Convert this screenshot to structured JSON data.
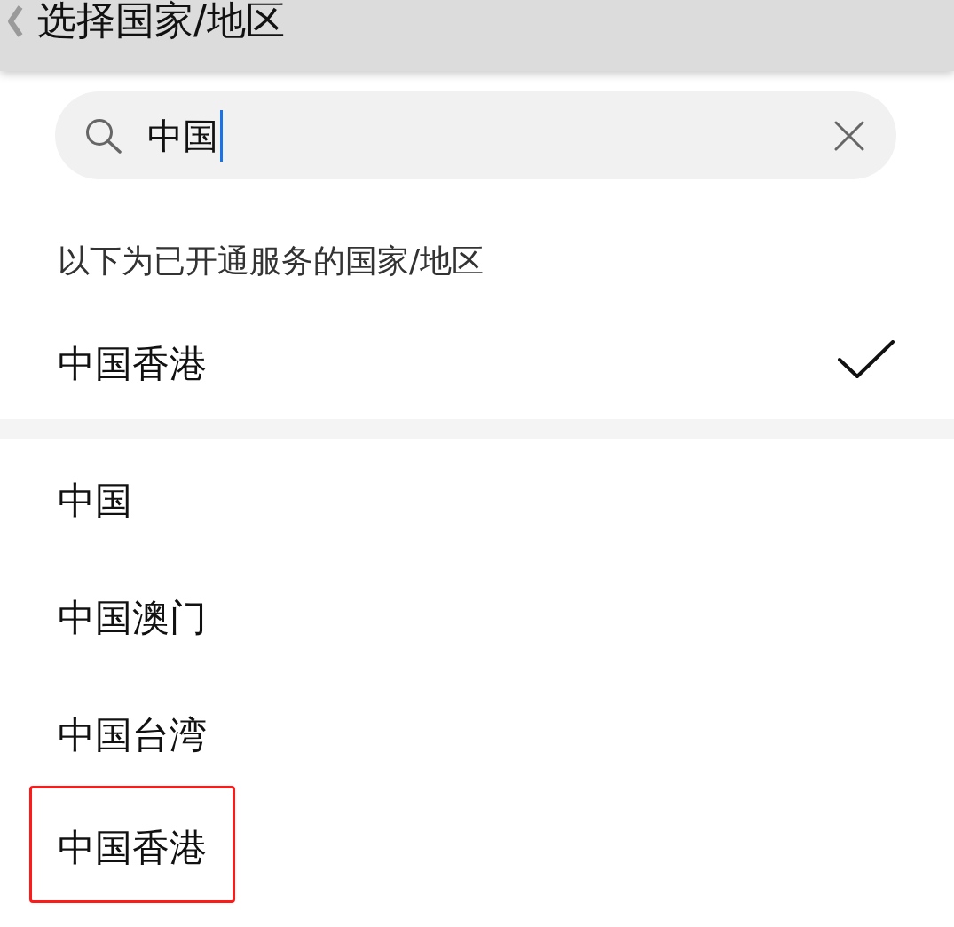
{
  "header": {
    "title": "选择国家/地区"
  },
  "search": {
    "value": "中国"
  },
  "section": {
    "label": "以下为已开通服务的国家/地区"
  },
  "current": {
    "name": "中国香港",
    "selected": true
  },
  "results": [
    {
      "name": "中国",
      "selected": false,
      "highlighted": false
    },
    {
      "name": "中国澳门",
      "selected": false,
      "highlighted": false
    },
    {
      "name": "中国台湾",
      "selected": false,
      "highlighted": false
    },
    {
      "name": "中国香港",
      "selected": false,
      "highlighted": true
    }
  ]
}
